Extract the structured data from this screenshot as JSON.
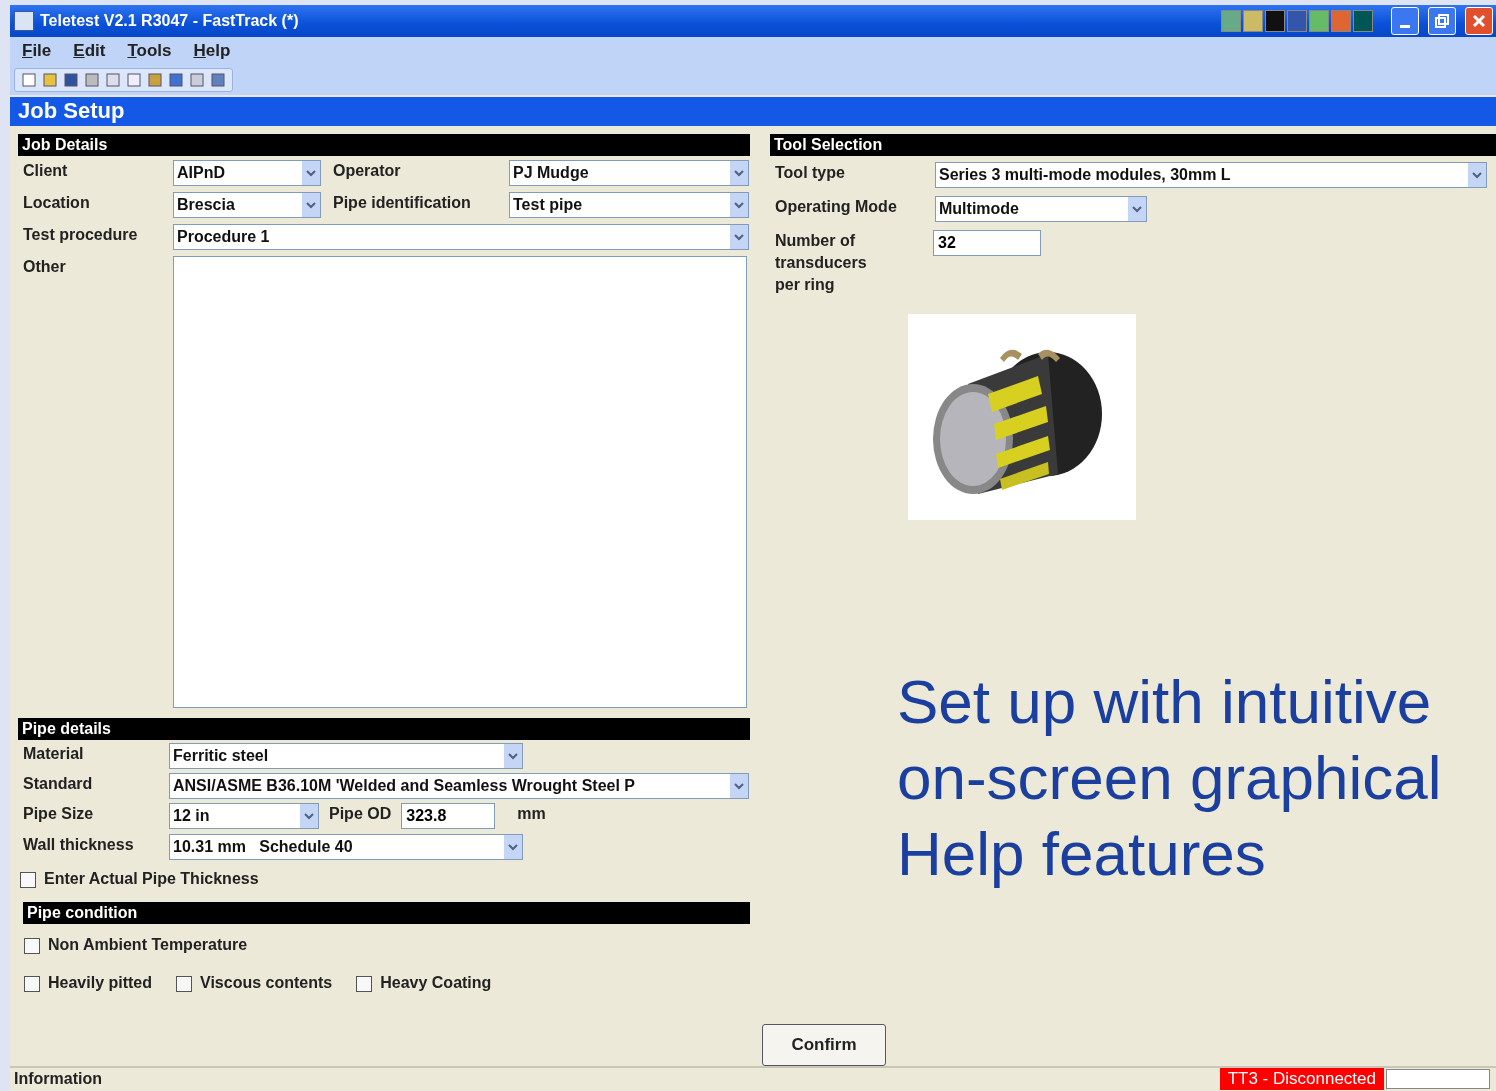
{
  "window": {
    "title": "Teletest V2.1 R3047 - FastTrack (*)"
  },
  "menu": [
    {
      "label": "File"
    },
    {
      "label": "Edit"
    },
    {
      "label": "Tools"
    },
    {
      "label": "Help"
    }
  ],
  "page_title": "Job Setup",
  "job_details": {
    "title": "Job Details",
    "client": {
      "label": "Client",
      "value": "AIPnD"
    },
    "operator": {
      "label": "Operator",
      "value": "PJ Mudge"
    },
    "location": {
      "label": "Location",
      "value": "Brescia"
    },
    "pipe_identification": {
      "label": "Pipe identification",
      "value": "Test pipe"
    },
    "test_procedure": {
      "label": "Test procedure",
      "value": "Procedure 1"
    },
    "other": {
      "label": "Other"
    }
  },
  "tool_selection": {
    "title": "Tool Selection",
    "tool_type": {
      "label": "Tool type",
      "value": "Series 3 multi-mode modules, 30mm L"
    },
    "operating_mode": {
      "label": "Operating Mode",
      "value": "Multimode"
    },
    "transducers": {
      "label": "Number of transducers per ring",
      "value": "32"
    }
  },
  "pipe_details": {
    "title": "Pipe details",
    "material": {
      "label": "Material",
      "value": "Ferritic steel"
    },
    "standard": {
      "label": "Standard",
      "value": "ANSI/ASME B36.10M 'Welded and Seamless Wrought Steel P"
    },
    "pipe_size": {
      "label": "Pipe Size",
      "value": "12 in"
    },
    "pipe_od": {
      "label": "Pipe OD",
      "value": "323.8",
      "unit": "mm"
    },
    "wall_thickness": {
      "label": "Wall thickness",
      "value": "10.31 mm   Schedule 40"
    },
    "actual_thickness": {
      "label": "Enter Actual Pipe Thickness",
      "checked": false
    }
  },
  "pipe_condition": {
    "title": "Pipe condition",
    "rows": [
      [
        {
          "label": "Non Ambient Temperature",
          "checked": false
        }
      ],
      [
        {
          "label": "Heavily pitted",
          "checked": false
        },
        {
          "label": "Viscous contents",
          "checked": false
        },
        {
          "label": "Heavy Coating",
          "checked": false
        }
      ]
    ]
  },
  "confirm_button": "Confirm",
  "caption": "Set up with intuitive on-screen graphical Help features",
  "status_bar": {
    "label": "Information",
    "connection": "TT3 - Disconnected"
  }
}
